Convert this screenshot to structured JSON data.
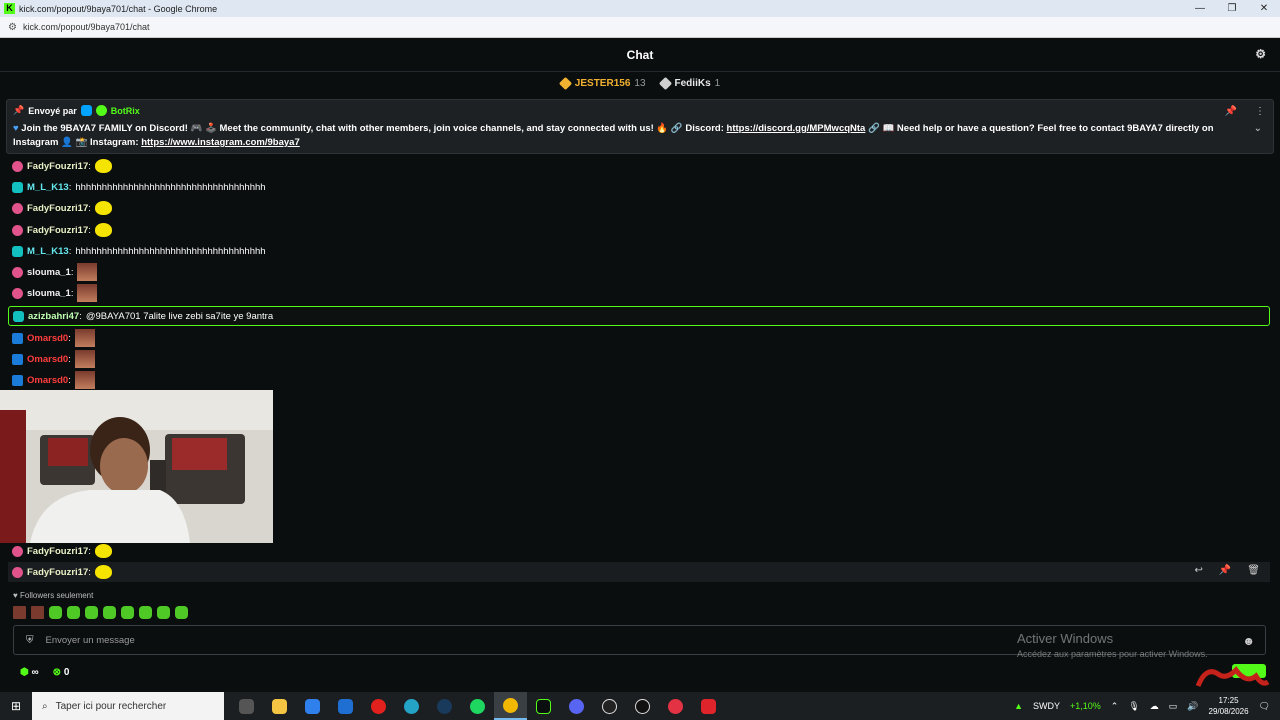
{
  "window": {
    "title": "kick.com/popout/9baya701/chat - Google Chrome",
    "url": "kick.com/popout/9baya701/chat"
  },
  "chat": {
    "title": "Chat"
  },
  "gifters": [
    {
      "name": "JESTER156",
      "count": "13"
    },
    {
      "name": "FediiKs",
      "count": "1"
    }
  ],
  "pinned": {
    "sent_by": "Envoyé par",
    "author": "BotRix",
    "text_1": "Join the 9BAYA7 FAMILY on Discord! 🎮 🕹️ Meet the community, chat with other members, join voice channels, and stay connected with us! 🔥 🔗 Discord: ",
    "link_1": "https://discord.gg/MPMwcqNta",
    "text_2": " 🔗 📖 Need help or have a question? Feel free to contact 9BAYA7 directly on Instagram 👤 📸 Instagram: ",
    "link_2": "https://www.instagram.com/9baya7"
  },
  "messages": [
    {
      "user": "FadyFouzri17",
      "text": ""
    },
    {
      "user": "M_L_K13",
      "text": "hhhhhhhhhhhhhhhhhhhhhhhhhhhhhhhhhhhh"
    },
    {
      "user": "FadyFouzri17",
      "text": ""
    },
    {
      "user": "FadyFouzri17",
      "text": ""
    },
    {
      "user": "M_L_K13",
      "text": "hhhhhhhhhhhhhhhhhhhhhhhhhhhhhhhhhhhh"
    },
    {
      "user": "slouma_1",
      "text": ""
    },
    {
      "user": "slouma_1",
      "text": ""
    },
    {
      "user": "azizbahri47",
      "text": "@9BAYA701 7alite live zebi sa7ite ye 9antra"
    },
    {
      "user": "Omarsd0",
      "text": ""
    },
    {
      "user": "Omarsd0",
      "text": ""
    },
    {
      "user": "Omarsd0",
      "text": ""
    },
    {
      "user": "FadyFouzri17",
      "text": ""
    },
    {
      "user": "FadyFouzri17",
      "text": ""
    }
  ],
  "followers_only": "Followers seulement",
  "input": {
    "placeholder": "Envoyer un message"
  },
  "activate_windows": {
    "title": "Activer Windows",
    "subtitle": "Accédez aux paramètres pour activer Windows."
  },
  "bottom": {
    "counter": "0"
  },
  "taskbar": {
    "search_placeholder": "Taper ici pour rechercher",
    "ticker": "SWDY",
    "ticker_change": "+1,10%",
    "time": "17:25",
    "date": "29/08/2026"
  },
  "colors": {
    "kick_green": "#53fc18",
    "pinned_bg": "#1e2124"
  }
}
